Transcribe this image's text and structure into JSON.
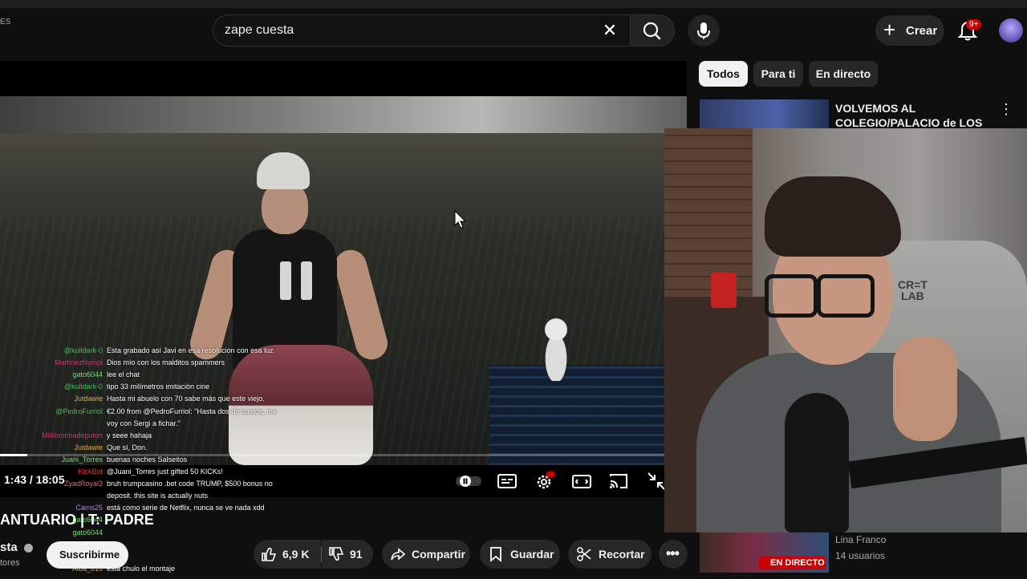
{
  "header": {
    "left_partial": "ES",
    "search_value": "zape cuesta",
    "create_label": "Crear",
    "notification_count": "9+"
  },
  "chips": [
    "Todos",
    "Para ti",
    "En directo"
  ],
  "recommended": {
    "title_line1": "VOLVEMOS AL",
    "title_line2": "COLEGIO/PALACIO de LOS ..."
  },
  "player": {
    "time": "1:43 / 18:05",
    "progress_fraction": 0.095
  },
  "chat": [
    {
      "user": "@kulldark-0",
      "color": "#3fbf57",
      "msg": "Esta grabado así Javi en esa resolucion con esa luz"
    },
    {
      "user": "MartinezNympl",
      "color": "#c0396b",
      "msg": "Dios mío con los malditos spammers"
    },
    {
      "user": "gato6044",
      "color": "#6ee36e",
      "msg": "lee el chat"
    },
    {
      "user": "@kulldark-0",
      "color": "#3fbf57",
      "msg": "tipo 33 milímetros imitación cine"
    },
    {
      "user": "Jutdawie",
      "color": "#e0a84a",
      "msg": "Hasta mi abuelo con 70 sabe más que este viejo."
    },
    {
      "user": "@PedroFurriol",
      "color": "#3fbf57",
      "msg": "€2.00 from @PedroFurriol: \"Hasta dos de bastos, me"
    },
    {
      "user": "",
      "color": "#ffffff",
      "msg": "voy con Sergi a fichar.\""
    },
    {
      "user": "Millibrotmadeputon",
      "color": "#c0396b",
      "msg": "y seee hahaja"
    },
    {
      "user": "Jutdawie",
      "color": "#e0a84a",
      "msg": "Que sí, Don."
    },
    {
      "user": "Juani_Torres",
      "color": "#6ee36e",
      "msg": "buenas noches Salseitos"
    },
    {
      "user": "KickBot",
      "color": "#e03a3a",
      "msg": "@Juani_Torres just gifted 50 KICKs!"
    },
    {
      "user": "ZyadRoyal3",
      "color": "#e36e6e",
      "msg": "bruh trumpcasino .bet code TRUMP, $500 bonus no"
    },
    {
      "user": "",
      "color": "#ffffff",
      "msg": "deposit. this site is actually nuts"
    },
    {
      "user": "Cams25",
      "color": "#b77ef0",
      "msg": "está como serie de Netflix, nunca se ve nada xdd"
    },
    {
      "user": "gato6044",
      "color": "#6ee36e",
      "msg": ""
    },
    {
      "user": "gato6044",
      "color": "#6ee36e",
      "msg": ""
    },
    {
      "user": "gato6044",
      "color": "#6ee36e",
      "msg": ""
    },
    {
      "user": "gato6044",
      "color": "#6ee36e",
      "msg": ""
    },
    {
      "user": "Alba_b16",
      "color": "#e0a84a",
      "msg": "esta chulo el montaje"
    }
  ],
  "video": {
    "title": "ANTUARIO | T:  PADRE",
    "channel": "sta",
    "subs": "tores",
    "subscribe_label": "Suscribirme"
  },
  "actions": {
    "likes": "6,9 K",
    "dislikes": "91",
    "share": "Compartir",
    "save": "Guardar",
    "clip": "Recortar"
  },
  "live_rec": {
    "name": "Lina Franco",
    "viewers": "14 usuarios",
    "badge": "EN DIRECTO"
  },
  "webcam": {
    "chair_text_1": "CR=T",
    "chair_text_2": "LAB"
  },
  "colors": {
    "live_red": "#cc0000",
    "bg": "#0f0f0f"
  }
}
